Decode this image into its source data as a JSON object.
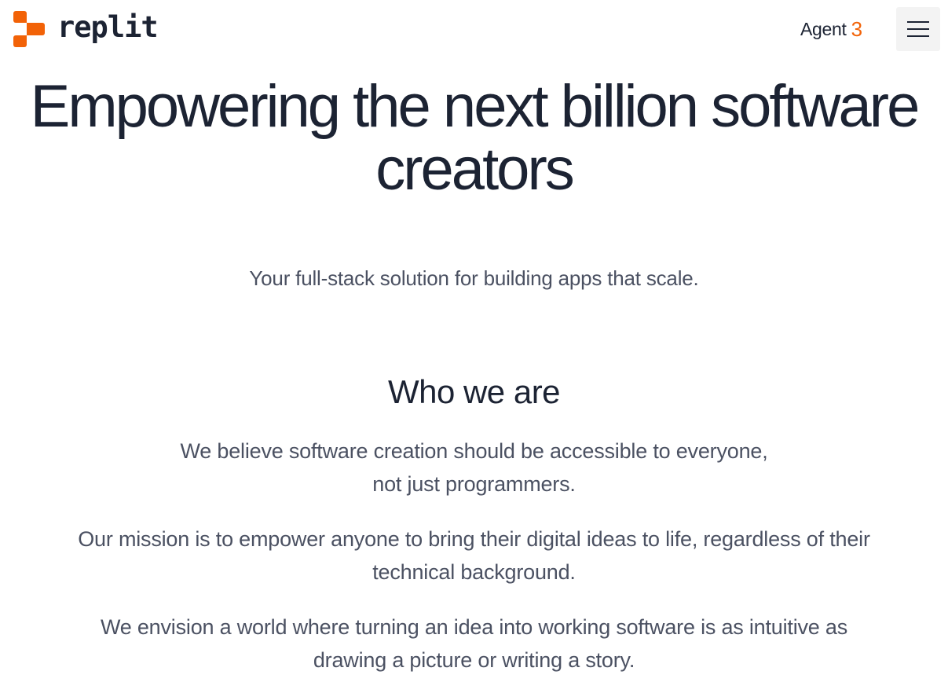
{
  "header": {
    "logo_text": "replit",
    "logo_colors": [
      "#f26207",
      "#f26207",
      "#f26207"
    ],
    "agent_label": "Agent",
    "agent_number": "3",
    "agent_color": "#f26207",
    "menu_icon": "hamburger-menu-icon"
  },
  "hero": {
    "title_line1": "Empowering the next billion software",
    "title_line2": "creators",
    "subtitle": "Your full-stack solution for building apps that scale."
  },
  "about": {
    "heading": "Who we are",
    "paragraphs": [
      {
        "line1": "We believe software creation should be accessible to everyone,",
        "line2": "not just programmers."
      },
      {
        "line1": "Our mission is to empower anyone to bring their digital ideas to life, regardless of their",
        "line2": "technical background."
      },
      {
        "line1": "We envision a world where turning an idea into working software is as intuitive as",
        "line2": "drawing a picture or writing a story."
      }
    ]
  },
  "colors": {
    "text_primary": "#1c2333",
    "text_secondary": "#4b5162",
    "brand": "#f26207",
    "background": "#ffffff"
  }
}
